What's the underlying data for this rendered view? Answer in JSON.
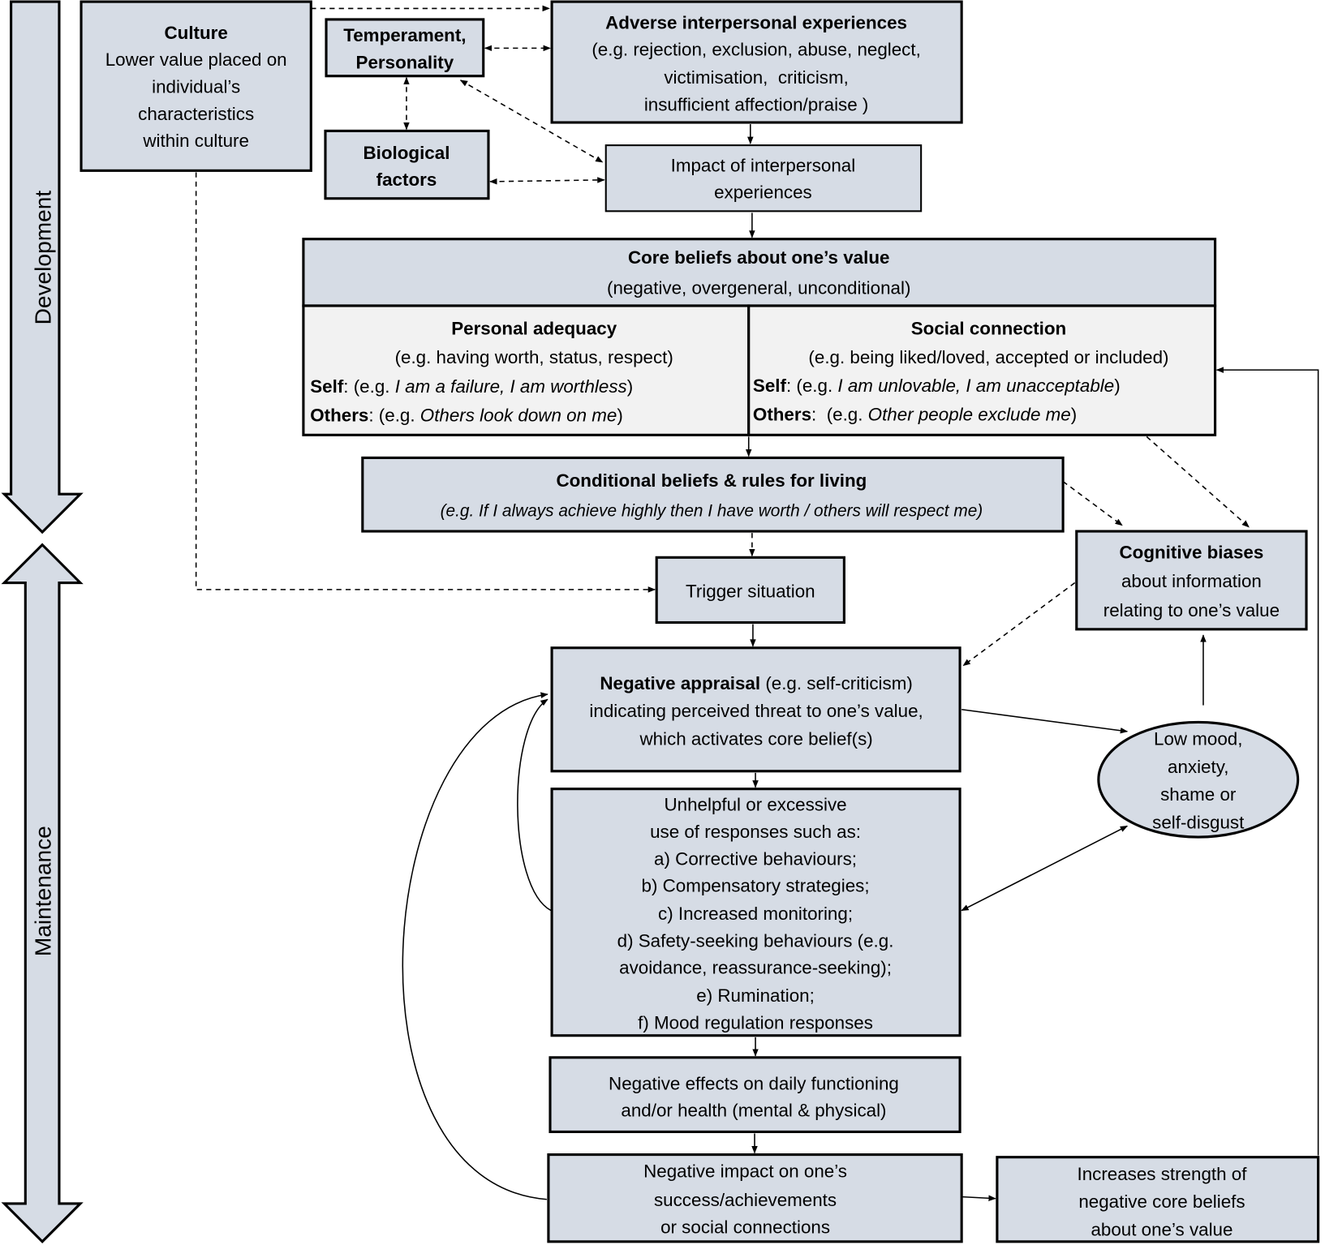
{
  "side_labels": {
    "development": "Development",
    "maintenance": "Maintenance"
  },
  "colors": {
    "box_fill": "#d6dce5",
    "sub_box_fill": "#f2f2f2",
    "stroke": "#000000"
  },
  "nodes": {
    "culture": {
      "lines": [
        [
          {
            "b": "Culture"
          }
        ],
        [
          {
            "t": "Lower value placed on"
          }
        ],
        [
          {
            "t": "individual’s"
          }
        ],
        [
          {
            "t": "characteristics"
          }
        ],
        [
          {
            "t": "within culture"
          }
        ]
      ]
    },
    "temperament": {
      "lines": [
        [
          {
            "b": "Temperament,"
          }
        ],
        [
          {
            "b": "Personality"
          }
        ]
      ]
    },
    "biological": {
      "lines": [
        [
          {
            "b": "Biological"
          }
        ],
        [
          {
            "b": "factors"
          }
        ]
      ]
    },
    "adverse": {
      "lines": [
        [
          {
            "b": "Adverse interpersonal experiences"
          }
        ],
        [
          {
            "t": "(e.g. rejection, exclusion, abuse, neglect,"
          }
        ],
        [
          {
            "t": "victimisation,  criticism,"
          }
        ],
        [
          {
            "t": "insufficient affection/praise )"
          }
        ]
      ]
    },
    "impact": {
      "lines": [
        [
          {
            "t": "Impact of interpersonal"
          }
        ],
        [
          {
            "t": "experiences"
          }
        ]
      ]
    },
    "core": {
      "lines": [
        [
          {
            "b": "Core beliefs about one’s value"
          }
        ],
        [
          {
            "t": "(negative, overgeneral, unconditional)"
          }
        ]
      ]
    },
    "personal": {
      "lines": [
        [
          {
            "b": "Personal adequacy"
          }
        ],
        [
          {
            "t": "(e.g. having worth, status, respect)"
          }
        ],
        [
          {
            "b": "Self"
          },
          {
            "t": ": (e.g. "
          },
          {
            "i": "I am a failure, I am worthless"
          },
          {
            "t": ")"
          }
        ],
        [
          {
            "b": "Others"
          },
          {
            "t": ": (e.g. "
          },
          {
            "i": "Others look down on me"
          },
          {
            "t": ")"
          }
        ]
      ]
    },
    "social": {
      "lines": [
        [
          {
            "b": "Social connection"
          }
        ],
        [
          {
            "t": "(e.g. being liked/loved, accepted or included)"
          }
        ],
        [
          {
            "b": "Self"
          },
          {
            "t": ": (e.g. "
          },
          {
            "i": "I am unlovable, I am unacceptable"
          },
          {
            "t": ")"
          }
        ],
        [
          {
            "b": "Others"
          },
          {
            "t": ":  (e.g. "
          },
          {
            "i": "Other people exclude me"
          },
          {
            "t": ")"
          }
        ]
      ]
    },
    "conditional": {
      "lines": [
        [
          {
            "b": "Conditional beliefs & rules for living"
          }
        ],
        [
          {
            "i": "(e.g. If I always achieve highly then I have worth / others will respect me)"
          }
        ]
      ]
    },
    "trigger": {
      "lines": [
        [
          {
            "t": "Trigger situation"
          }
        ]
      ]
    },
    "cognitive": {
      "lines": [
        [
          {
            "b": "Cognitive biases"
          }
        ],
        [
          {
            "t": "about information"
          }
        ],
        [
          {
            "t": "relating to one’s value"
          }
        ]
      ]
    },
    "appraisal": {
      "lines": [
        [
          {
            "b": "Negative appraisal"
          },
          {
            "t": " (e.g. self-criticism)"
          }
        ],
        [
          {
            "t": "indicating perceived threat to one’s value,"
          }
        ],
        [
          {
            "t": "which activates core belief(s)"
          }
        ]
      ]
    },
    "mood": {
      "lines": [
        [
          {
            "t": "Low mood,"
          }
        ],
        [
          {
            "t": "anxiety,"
          }
        ],
        [
          {
            "t": "shame or"
          }
        ],
        [
          {
            "t": "self-disgust"
          }
        ]
      ]
    },
    "responses": {
      "lines": [
        [
          {
            "t": "Unhelpful or excessive"
          }
        ],
        [
          {
            "t": "use of responses such as:"
          }
        ],
        [
          {
            "t": "a) Corrective behaviours;"
          }
        ],
        [
          {
            "t": "b) Compensatory strategies;"
          }
        ],
        [
          {
            "t": "c) Increased monitoring;"
          }
        ],
        [
          {
            "t": "d) Safety-seeking behaviours (e.g."
          }
        ],
        [
          {
            "t": "avoidance, reassurance-seeking);"
          }
        ],
        [
          {
            "t": "e) Rumination;"
          }
        ],
        [
          {
            "t": "f) Mood regulation responses"
          }
        ]
      ]
    },
    "effects": {
      "lines": [
        [
          {
            "t": "Negative effects on daily functioning"
          }
        ],
        [
          {
            "t": "and/or health (mental & physical)"
          }
        ]
      ]
    },
    "success": {
      "lines": [
        [
          {
            "t": "Negative impact on one’s"
          }
        ],
        [
          {
            "t": "success/achievements"
          }
        ],
        [
          {
            "t": "or social connections"
          }
        ]
      ]
    },
    "strength": {
      "lines": [
        [
          {
            "t": "Increases strength of"
          }
        ],
        [
          {
            "t": "negative core beliefs"
          }
        ],
        [
          {
            "t": "about one’s value"
          }
        ]
      ]
    }
  }
}
